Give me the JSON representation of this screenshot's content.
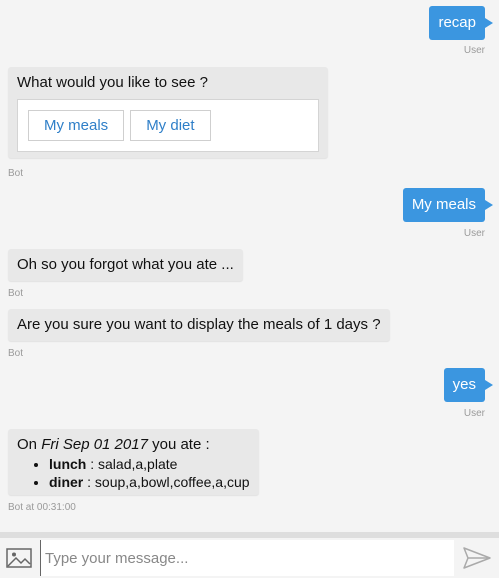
{
  "messages": {
    "m1": {
      "text": "recap",
      "meta": "User"
    },
    "m2": {
      "text": "What would you like to see ?",
      "meta": "Bot",
      "choices": [
        "My meals",
        "My diet"
      ]
    },
    "m3": {
      "text": "My meals",
      "meta": "User"
    },
    "m4": {
      "text": "Oh so you forgot what you ate ...",
      "meta": "Bot"
    },
    "m5": {
      "text": "Are you sure you want to display the meals of 1 days ?",
      "meta": "Bot"
    },
    "m6": {
      "text": "yes",
      "meta": "User"
    },
    "m7": {
      "prefix": "On ",
      "date": "Fri Sep 01 2017",
      "suffix": " you ate :",
      "items": [
        {
          "label": "lunch",
          "value": " : salad,a,plate"
        },
        {
          "label": "diner",
          "value": " : soup,a,bowl,coffee,a,cup"
        }
      ],
      "meta": "Bot at 00:31:00"
    }
  },
  "composer": {
    "placeholder": "Type your message..."
  },
  "icons": {
    "attach": "image-icon",
    "send": "send-icon"
  }
}
